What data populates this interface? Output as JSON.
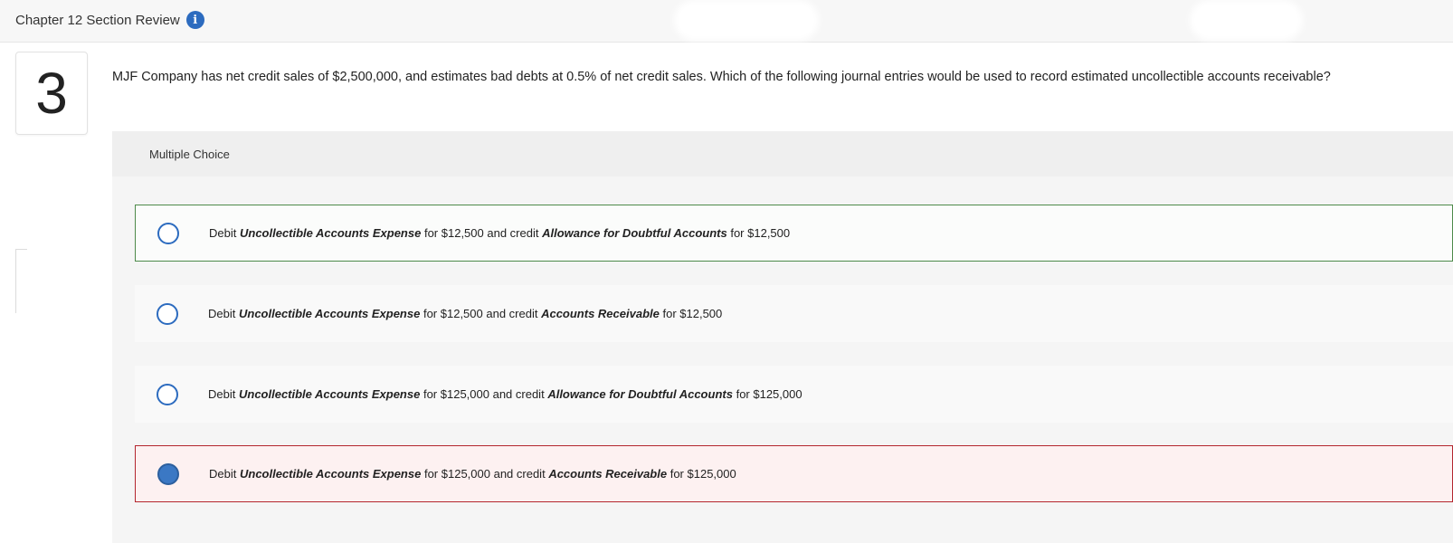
{
  "header": {
    "title": "Chapter 12 Section Review",
    "info_icon": "info-icon"
  },
  "question": {
    "number": "3",
    "text": "MJF Company has net credit sales of $2,500,000, and estimates bad debts at 0.5% of net credit sales. Which of the following journal entries would be used to record estimated uncollectible accounts receivable?"
  },
  "multiple_choice": {
    "label": "Multiple Choice",
    "options": [
      {
        "state": "correct",
        "selected": false,
        "debit_prefix": "Debit",
        "debit_account": "Uncollectible Accounts Expense",
        "debit_amount": "for $12,500 and credit",
        "credit_account": "Allowance for Doubtful Accounts",
        "credit_amount": "for $12,500"
      },
      {
        "state": "neutral",
        "selected": false,
        "debit_prefix": "Debit",
        "debit_account": "Uncollectible Accounts Expense",
        "debit_amount": "for $12,500 and credit",
        "credit_account": "Accounts Receivable",
        "credit_amount": "for $12,500"
      },
      {
        "state": "neutral",
        "selected": false,
        "debit_prefix": "Debit",
        "debit_account": "Uncollectible Accounts Expense",
        "debit_amount": "for $125,000 and credit",
        "credit_account": "Allowance for Doubtful Accounts",
        "credit_amount": "for $125,000"
      },
      {
        "state": "incorrect",
        "selected": true,
        "debit_prefix": "Debit",
        "debit_account": "Uncollectible Accounts Expense",
        "debit_amount": "for $125,000 and credit",
        "credit_account": "Accounts Receivable",
        "credit_amount": "for $125,000"
      }
    ]
  },
  "colors": {
    "accent": "#2c6bbf",
    "correct_border": "#4d8a4a",
    "incorrect_border": "#b3262e",
    "incorrect_bg": "#fdf1f1"
  }
}
